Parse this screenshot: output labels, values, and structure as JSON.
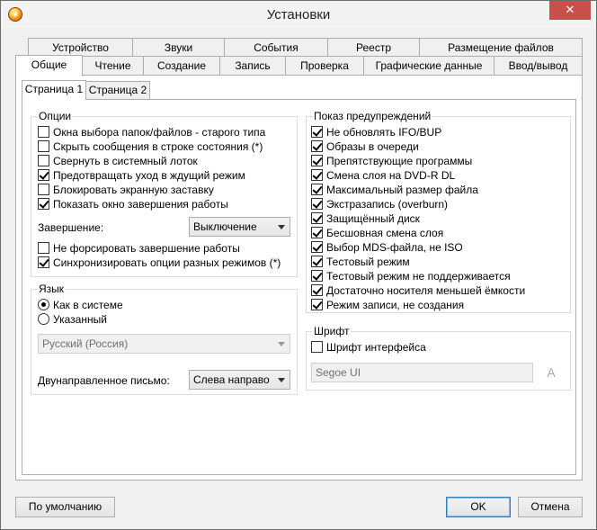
{
  "window": {
    "title": "Установки"
  },
  "tabs_row1": [
    "Устройство",
    "Звуки",
    "События",
    "Реестр",
    "Размещение файлов"
  ],
  "tabs_row2": [
    "Общие",
    "Чтение",
    "Создание",
    "Запись",
    "Проверка",
    "Графические данные",
    "Ввод/вывод"
  ],
  "subtabs": [
    "Страница 1",
    "Страница 2"
  ],
  "options": {
    "title": "Опции",
    "items": [
      {
        "label": "Окна выбора папок/файлов - старого типа",
        "checked": false
      },
      {
        "label": "Скрыть сообщения в строке состояния (*)",
        "checked": false
      },
      {
        "label": "Свернуть в системный лоток",
        "checked": false
      },
      {
        "label": "Предотвращать уход в ждущий режим",
        "checked": true
      },
      {
        "label": "Блокировать экранную заставку",
        "checked": false
      },
      {
        "label": "Показать окно завершения работы",
        "checked": true
      }
    ],
    "shutdown_label": "Завершение:",
    "shutdown_value": "Выключение",
    "items2": [
      {
        "label": "Не форсировать завершение работы",
        "checked": false
      },
      {
        "label": "Синхронизировать опции разных режимов (*)",
        "checked": true
      }
    ]
  },
  "language": {
    "title": "Язык",
    "radio_system": "Как в системе",
    "radio_custom": "Указанный",
    "selected": "system",
    "lang_value": "Русский (Россия)",
    "bidi_label": "Двунаправленное письмо:",
    "bidi_value": "Слева направо"
  },
  "warnings": {
    "title": "Показ предупреждений",
    "items": [
      {
        "label": "Не обновлять IFO/BUP",
        "checked": true
      },
      {
        "label": "Образы в очереди",
        "checked": true
      },
      {
        "label": "Препятствующие программы",
        "checked": true
      },
      {
        "label": "Смена слоя на DVD-R DL",
        "checked": true
      },
      {
        "label": "Максимальный размер файла",
        "checked": true
      },
      {
        "label": "Экстразапись (overburn)",
        "checked": true
      },
      {
        "label": "Защищённый диск",
        "checked": true
      },
      {
        "label": "Бесшовная смена слоя",
        "checked": true
      },
      {
        "label": "Выбор MDS-файла, не ISO",
        "checked": true
      },
      {
        "label": "Тестовый режим",
        "checked": true
      },
      {
        "label": "Тестовый режим не поддерживается",
        "checked": true
      },
      {
        "label": "Достаточно носителя меньшей ёмкости",
        "checked": true
      },
      {
        "label": "Режим записи, не создания",
        "checked": true
      }
    ]
  },
  "font": {
    "title": "Шрифт",
    "interface_font_label": "Шрифт интерфейса",
    "interface_font_checked": false,
    "font_value": "Segoe UI"
  },
  "buttons": {
    "defaults": "По умолчанию",
    "ok": "OK",
    "cancel": "Отмена"
  }
}
